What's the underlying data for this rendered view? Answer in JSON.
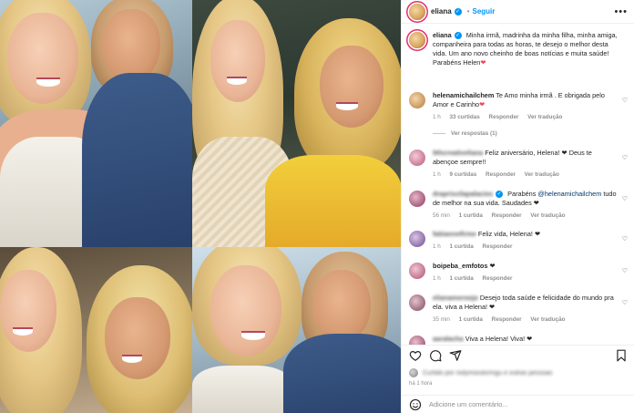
{
  "header": {
    "username": "eliana",
    "verified": true,
    "separator": "•",
    "follow_label": "Seguir",
    "more_label": "•••"
  },
  "caption": {
    "username": "eliana",
    "text": " Minha irmã, madrinha da minha filha, minha amiga, companheira para todas as horas, te desejo o melhor desta vida. Um ano novo cheinho de boas notícias e muita saúde! Parabéns Helen"
  },
  "comments": [
    {
      "username": "helenamichailchem",
      "text": " Te Amo minha irmã . E obrigada pelo Amor e Carinho",
      "heart": "❤",
      "time": "1 h",
      "likes": "33 curtidas",
      "reply": "Responder",
      "translate": "Ver tradução",
      "view_replies": "Ver respostas (1)"
    },
    {
      "username": "5thcreativeliana",
      "text": " Feliz aniversário, Helena! ❤ Deus te abençoe sempre!!",
      "time": "1 h",
      "likes": "9 curtidas",
      "reply": "Responder",
      "translate": "Ver tradução"
    },
    {
      "username": "drapriscilapalacios",
      "text_before": " Parabéns ",
      "mention": "@helenamichailchem",
      "text_after": " tudo de melhor na sua vida. Saudades ❤",
      "time": "56 min",
      "likes": "1 curtida",
      "reply": "Responder",
      "translate": "Ver tradução"
    },
    {
      "username": "fabiannefirme",
      "text": " Feliz vida, Helena! ❤",
      "time": "1 h",
      "likes": "1 curtida",
      "reply": "Responder"
    },
    {
      "username": "boipeba_emfotos",
      "text": " ❤",
      "time": "1 h",
      "likes": "1 curtida",
      "reply": "Responder"
    },
    {
      "username": "elianamoroojo",
      "text": " Desejo toda saúde e felicidade do mundo pra ela. viva a Helena! ❤",
      "time": "35 min",
      "likes": "1 curtida",
      "reply": "Responder",
      "translate": "Ver tradução"
    },
    {
      "username": "aaralacha",
      "text": " Viva a Helena! Viva! ❤"
    }
  ],
  "liked_by": "Curtido por rodymoiutormgu e outras pessoas",
  "post_time": "há 1 hora",
  "add_comment": {
    "placeholder": "Adicione um comentário..."
  },
  "colors": {
    "accent_blue": "#0095f6",
    "heart_red": "#ed4956",
    "muted_text": "#8e8e8e"
  },
  "icons": {
    "emoji": "smiley-icon",
    "like": "heart-icon",
    "comment": "comment-icon",
    "share": "send-icon",
    "save": "bookmark-icon"
  }
}
